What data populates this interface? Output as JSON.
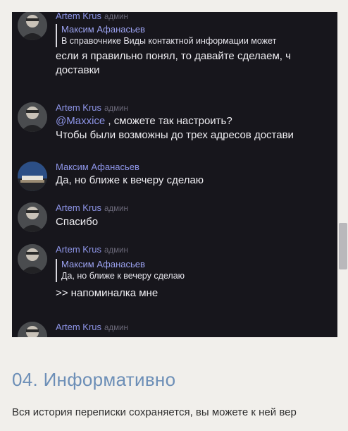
{
  "chat": {
    "messages": [
      {
        "sender": "Artem Krus",
        "role": "админ",
        "quote": {
          "name": "Максим Афанасьев",
          "text": "В справочнике Виды контактной информации может"
        },
        "lines": [
          "если я правильно понял, то давайте сделаем, ч",
          "доставки"
        ]
      },
      {
        "sender": "Artem Krus",
        "role": "админ",
        "mention": "@Maxxice",
        "first_line_rest": " , сможете так настроить?",
        "lines": [
          "Чтобы были возможны до трех адресов достави"
        ]
      },
      {
        "sender": "Максим Афанасьев",
        "lines": [
          "Да, но ближе к вечеру сделаю"
        ]
      },
      {
        "sender": "Artem Krus",
        "role": "админ",
        "lines": [
          "Спасибо"
        ]
      },
      {
        "sender": "Artem Krus",
        "role": "админ",
        "quote": {
          "name": "Максим Афанасьев",
          "text": "Да, но ближе к вечеру сделаю"
        },
        "lines": [
          ">> напоминалка мне"
        ]
      },
      {
        "sender": "Artem Krus",
        "role": "админ"
      }
    ]
  },
  "section": {
    "heading": "04. Информативно",
    "paragraph": "Вся история переписки сохраняется, вы можете к ней вер"
  },
  "colors": {
    "chat_background": "#17161c",
    "sender_name": "#8e95e8",
    "heading": "#6d8fb7",
    "page_background": "#f1efeb"
  },
  "icons": [
    "artem-avatar",
    "maksim-avatar"
  ]
}
